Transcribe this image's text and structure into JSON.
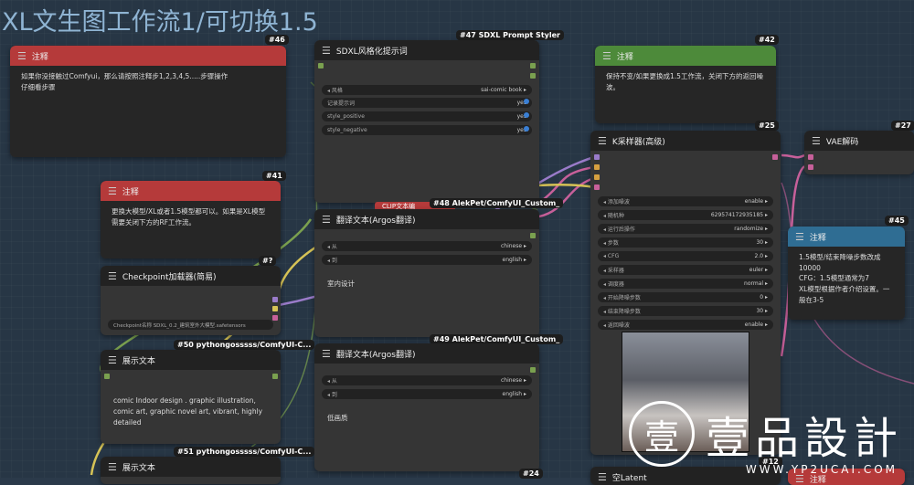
{
  "canvas": {
    "group_title": "XL文生图工作流1/可切换1.5"
  },
  "colors": {
    "note_red": "#b53a3a",
    "note_green": "#4d8a3a",
    "note_blue": "#2f6d93",
    "wire_yellow": "#d6c356",
    "wire_pink": "#c7609a",
    "wire_purple": "#9a7bc9",
    "wire_green": "#7aa04f"
  },
  "nodes": {
    "note46": {
      "badge": "#46",
      "title": "注释",
      "body": "如果你没接触过Comfyui，那么请按照注释步1,2,3,4,5.....步骤操作\n仔细看步骤"
    },
    "sdxl_styler": {
      "badge": "#47 SDXL Prompt Styler",
      "title": "SDXL风格化提示词",
      "widgets": [
        {
          "name": "风格",
          "value": "sai-comic book"
        },
        {
          "name": "记录提示词",
          "value": "yes"
        },
        {
          "name": "style_positive",
          "value": "yes"
        },
        {
          "name": "style_negative",
          "value": "yes"
        }
      ]
    },
    "note42": {
      "badge": "#42",
      "title": "注释",
      "body": "保持不变/如果更换成1.5工作流，关闭下方的返回噪波。"
    },
    "ksampler": {
      "badge": "#25",
      "title": "K采样器(高级)",
      "widgets": [
        {
          "name": "添加噪波",
          "value": "enable"
        },
        {
          "name": "随机种",
          "value": "629574172935185"
        },
        {
          "name": "运行后操作",
          "value": "randomize"
        },
        {
          "name": "步数",
          "value": "30"
        },
        {
          "name": "CFG",
          "value": "2.0"
        },
        {
          "name": "采样器",
          "value": "euler"
        },
        {
          "name": "调度器",
          "value": "normal"
        },
        {
          "name": "开始降噪步数",
          "value": "0"
        },
        {
          "name": "结束降噪步数",
          "value": "30"
        },
        {
          "name": "返回噪波",
          "value": "enable"
        }
      ]
    },
    "vae": {
      "badge": "#27",
      "title": "VAE解码"
    },
    "note41": {
      "badge": "#41",
      "title": "注释",
      "body": "更换大模型/XL或者1.5模型都可以。如果是XL模型需要关闭下方的RF工作流。"
    },
    "clip_label": "CLIP文本编",
    "translate1": {
      "badge": "#48 AlekPet/ComfyUI_Custom_",
      "title": "翻译文本(Argos翻译)",
      "widgets": [
        {
          "name": "从",
          "value": "chinese"
        },
        {
          "name": "到",
          "value": "english"
        }
      ],
      "text": "室内设计"
    },
    "checkpoint": {
      "badge": "#?",
      "title": "Checkpoint加载器(简易)",
      "ckpt": "Checkpoint名称 SDXL_0.2_建筑室外大模型.safetensors"
    },
    "note45": {
      "badge": "#45",
      "title": "注释",
      "body": "1.5模型/结束降噪步数改成10000\nCFG：1.5模型通常为7\nXL模型根据作者介绍设置。一般在3-5"
    },
    "show1": {
      "badge": "#50 pythongosssss/ComfyUI-C...",
      "title": "展示文本",
      "text": "comic Indoor design . graphic illustration, comic art, graphic novel art, vibrant, highly detailed"
    },
    "translate2": {
      "badge": "#49 AlekPet/ComfyUI_Custom_",
      "title": "翻译文本(Argos翻译)",
      "widgets": [
        {
          "name": "从",
          "value": "chinese"
        },
        {
          "name": "到",
          "value": "english"
        }
      ],
      "text": "低画质"
    },
    "show2": {
      "badge": "#51 pythongosssss/ComfyUI-C...",
      "title": "展示文本"
    },
    "latent": {
      "title": "空Latent"
    },
    "note_small": {
      "title": "注释"
    },
    "bottom_badge": "#24",
    "bottom_badge2": "#12"
  },
  "logo": {
    "text": "壹品設計",
    "url": "WWW.YP2UCAI.COM",
    "icon": "stamp-logo-icon"
  }
}
